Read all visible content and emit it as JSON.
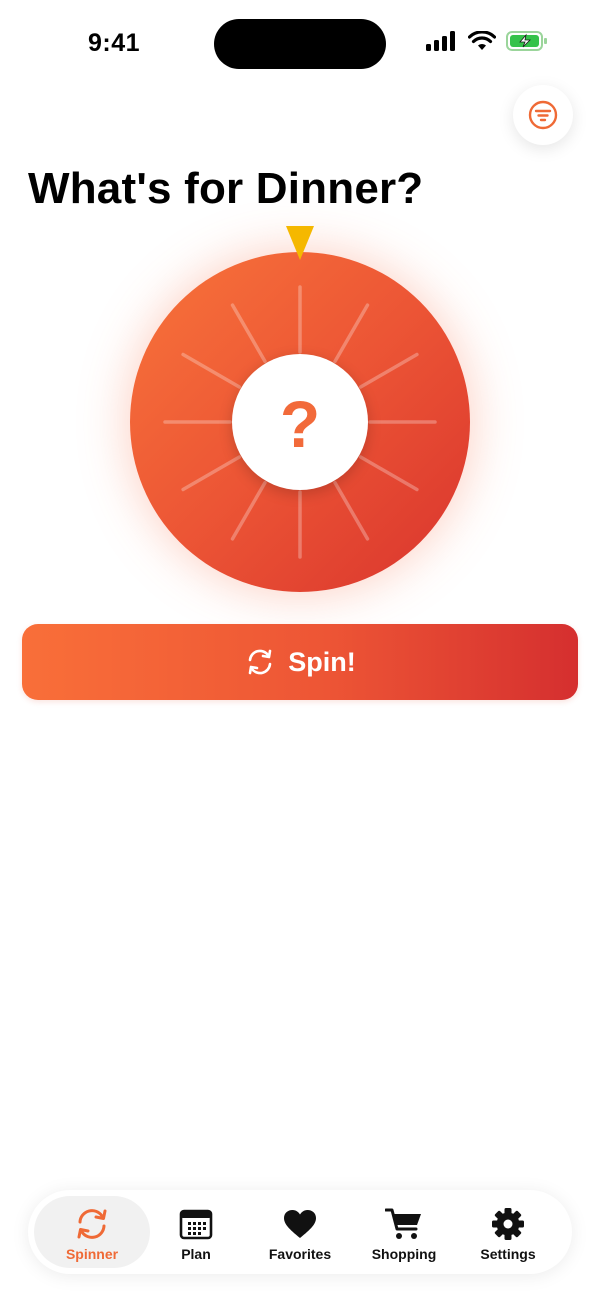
{
  "status_bar": {
    "time": "9:41"
  },
  "header": {
    "title": "What's for Dinner?",
    "filter_icon": "filter-icon"
  },
  "wheel": {
    "center_text": "?",
    "pointer_color": "#f5b800",
    "gradient": [
      "#f8743a",
      "#ec5535",
      "#d9342d"
    ]
  },
  "spin_button": {
    "label": "Spin!",
    "icon": "refresh-icon"
  },
  "tabbar": {
    "active": "Spinner",
    "accent": "#ef6a36",
    "tabs": [
      {
        "label": "Spinner",
        "icon": "refresh-icon"
      },
      {
        "label": "Plan",
        "icon": "calendar-icon"
      },
      {
        "label": "Favorites",
        "icon": "heart-icon"
      },
      {
        "label": "Shopping",
        "icon": "cart-icon"
      },
      {
        "label": "Settings",
        "icon": "gear-icon"
      }
    ]
  }
}
